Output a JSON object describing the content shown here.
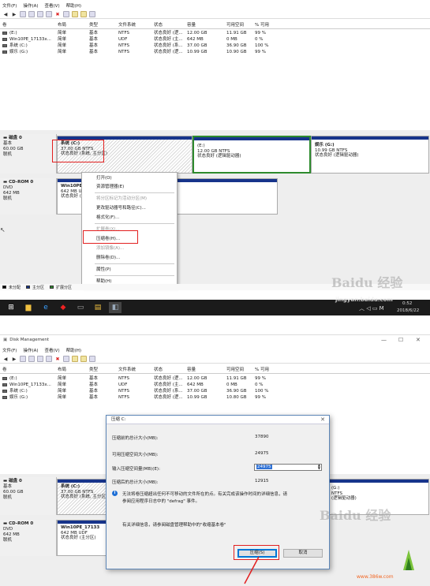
{
  "top": {
    "menu": [
      "文件(F)",
      "操作(A)",
      "查看(V)",
      "帮助(H)"
    ],
    "columns": [
      "卷",
      "布局",
      "类型",
      "文件系统",
      "状态",
      "容量",
      "可用空间",
      "% 可用"
    ],
    "volumes": [
      {
        "name": "(E:)",
        "layout": "简单",
        "type": "基本",
        "fs": "NTFS",
        "status": "状态良好 (逻...",
        "capacity": "12.00 GB",
        "free": "11.91 GB",
        "pct": "99 %"
      },
      {
        "name": "Win10PE_17133x...",
        "layout": "简单",
        "type": "基本",
        "fs": "UDF",
        "status": "状态良好 (主...",
        "capacity": "642 MB",
        "free": "0 MB",
        "pct": "0 %"
      },
      {
        "name": "系统 (C:)",
        "layout": "简单",
        "type": "基本",
        "fs": "NTFS",
        "status": "状态良好 (系...",
        "capacity": "37.00 GB",
        "free": "36.90 GB",
        "pct": "100 %"
      },
      {
        "name": "娱乐 (G:)",
        "layout": "简单",
        "type": "基本",
        "fs": "NTFS",
        "status": "状态良好 (逻...",
        "capacity": "10.99 GB",
        "free": "10.90 GB",
        "pct": "99 %"
      }
    ],
    "disk0": {
      "title": "磁盘 0",
      "type": "基本",
      "size": "60.00 GB",
      "state": "联机"
    },
    "c_vol": {
      "name": "系统  (C:)",
      "size": "37.00 GB NTFS",
      "status": "状态良好 (系统, 主分区)"
    },
    "e_vol": {
      "name": "(E:)",
      "size": "12.00 GB NTFS",
      "status": "状态良好 (逻辑驱动器)"
    },
    "g_vol": {
      "name": "娱乐  (G:)",
      "size": "10.99 GB NTFS",
      "status": "状态良好 (逻辑驱动器)"
    },
    "cdrom": {
      "title": "CD-ROM 0",
      "type": "DVD",
      "size": "642 MB",
      "state": "联机"
    },
    "win_vol": {
      "name": "Win10PE_17133",
      "size": "642 MB UDF",
      "status": "状态良好 (主分区)"
    },
    "context_menu": [
      {
        "label": "打开(O)",
        "disabled": false
      },
      {
        "label": "资源管理器(E)",
        "disabled": false
      },
      {
        "label": "将分区标记为活动分区(M)",
        "disabled": true
      },
      {
        "label": "更改驱动器号和路径(C)...",
        "disabled": false
      },
      {
        "label": "格式化(F)...",
        "disabled": false
      },
      {
        "label": "扩展卷(X)...",
        "disabled": true
      },
      {
        "label": "压缩卷(H)...",
        "disabled": false
      },
      {
        "label": "添加镜像(A)...",
        "disabled": true
      },
      {
        "label": "删除卷(D)...",
        "disabled": false
      },
      {
        "label": "属性(P)",
        "disabled": false
      },
      {
        "label": "帮助(H)",
        "disabled": false
      }
    ],
    "legend": [
      "未分配",
      "主分区",
      "扩展分区"
    ],
    "watermark_url": "jingyan.baidu.com",
    "clock": {
      "time": "0:52",
      "date": "2018/6/22"
    },
    "taskbar_icons": [
      "windows-start-icon",
      "file-explorer-icon",
      "ie-browser-icon",
      "red-app-icon",
      "cmd-icon",
      "folder-icon",
      "disk-management-icon"
    ]
  },
  "bottom": {
    "title": "Disk Management",
    "menu": [
      "文件(F)",
      "操作(A)",
      "查看(V)",
      "帮助(H)"
    ],
    "columns": [
      "卷",
      "布局",
      "类型",
      "文件系统",
      "状态",
      "容量",
      "可用空间",
      "% 可用"
    ],
    "volumes": [
      {
        "name": "(E:)",
        "layout": "简单",
        "type": "基本",
        "fs": "NTFS",
        "status": "状态良好 (逻...",
        "capacity": "12.00 GB",
        "free": "11.91 GB",
        "pct": "99 %"
      },
      {
        "name": "Win10PE_17133x...",
        "layout": "简单",
        "type": "基本",
        "fs": "UDF",
        "status": "状态良好 (主...",
        "capacity": "642 MB",
        "free": "0 MB",
        "pct": "0 %"
      },
      {
        "name": "系统 (C:)",
        "layout": "简单",
        "type": "基本",
        "fs": "NTFS",
        "status": "状态良好 (系...",
        "capacity": "37.00 GB",
        "free": "36.90 GB",
        "pct": "100 %"
      },
      {
        "name": "娱乐 (G:)",
        "layout": "简单",
        "type": "基本",
        "fs": "NTFS",
        "status": "状态良好 (逻...",
        "capacity": "10.99 GB",
        "free": "10.80 GB",
        "pct": "99 %"
      }
    ],
    "disk0": {
      "title": "磁盘 0",
      "type": "基本",
      "size": "60.00 GB",
      "state": "联机"
    },
    "c_vol": {
      "name": "系统  (C:)",
      "size": "37.00 GB NTFS",
      "status": "状态良好 (系统, 主分区)"
    },
    "g_vol": {
      "name": "(G:)",
      "size": "NTFS",
      "status": "(逻辑驱动器)"
    },
    "cdrom": {
      "title": "CD-ROM 0",
      "type": "DVD",
      "size": "642 MB",
      "state": "联机"
    },
    "win_vol": {
      "name": "Win10PE_17133",
      "size": "642 MB UDF",
      "status": "状态良好 (主分区)"
    },
    "dialog": {
      "title": "压缩 C:",
      "fields": [
        {
          "label": "压缩前的总计大小(MB):",
          "value": "37890"
        },
        {
          "label": "可用压缩空间大小(MB):",
          "value": "24975"
        },
        {
          "label": "输入压缩空间量(MB)(E):",
          "value": "24975"
        },
        {
          "label": "压缩后的总计大小(MB):",
          "value": "12915"
        }
      ],
      "info_text_1": "无法将卷压缩超出任何不可移动的文件所在的点。有关完成该操作时间的详细信息，请",
      "info_text_2": "参阅应用程序日志中的 \"defrag\" 事件。",
      "more_info": "有关详细信息，请参阅磁盘管理帮助中的\"收缩基本卷\"",
      "compress_button": "压缩(S)",
      "cancel_button": "取消"
    },
    "watermark_site": "www.386w.com"
  }
}
